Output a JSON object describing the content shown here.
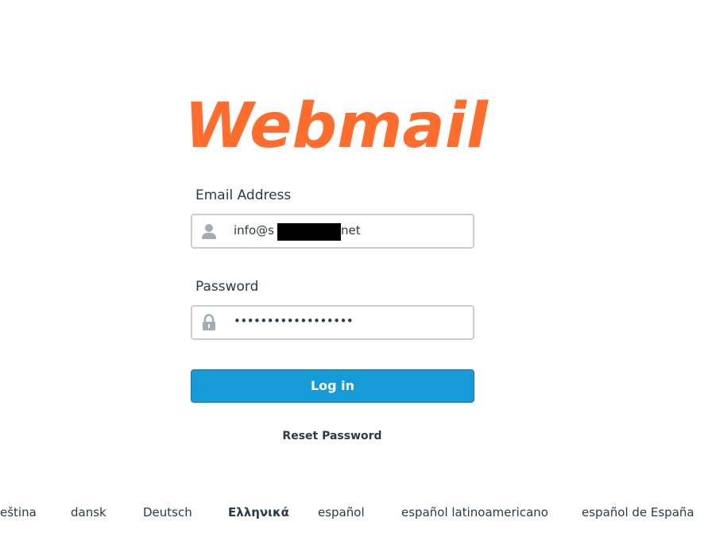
{
  "brand": {
    "logo_text": "Webmail",
    "color": "#ff6c2c"
  },
  "form": {
    "email": {
      "label": "Email Address",
      "value_visible_prefix": "info@s",
      "value_visible_suffix": "net",
      "icon": "user-icon"
    },
    "password": {
      "label": "Password",
      "value": "••••••••••••••••••",
      "icon": "lock-icon"
    },
    "login_label": "Log in",
    "login_color": "#179bd7",
    "reset_label": "Reset Password"
  },
  "languages": [
    {
      "label": "eština"
    },
    {
      "label": "dansk"
    },
    {
      "label": "Deutsch"
    },
    {
      "label": "Ελληνικά"
    },
    {
      "label": "español"
    },
    {
      "label": "español latinoamericano"
    },
    {
      "label": "español de España"
    }
  ]
}
